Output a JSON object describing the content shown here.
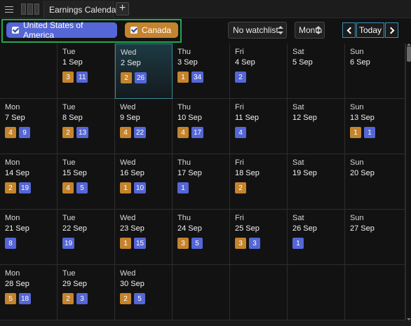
{
  "tab": {
    "title": "Earnings Calendar",
    "add_label": "+"
  },
  "filters": {
    "countries": [
      {
        "key": "usa",
        "label": "United States of America",
        "checked": true,
        "color": "#5566d6"
      },
      {
        "key": "can",
        "label": "Canada",
        "checked": true,
        "color": "#c4842d"
      }
    ],
    "watchlist": "No watchlist",
    "view": "Month",
    "today_label": "Today"
  },
  "calendar": {
    "weeks": [
      [
        null,
        {
          "dow": "Tue",
          "date": "1 Sep",
          "can": "3",
          "usa": "11"
        },
        {
          "dow": "Wed",
          "date": "2 Sep",
          "can": "2",
          "usa": "26",
          "today": true
        },
        {
          "dow": "Thu",
          "date": "3 Sep",
          "can": "1",
          "usa": "34"
        },
        {
          "dow": "Fri",
          "date": "4 Sep",
          "usa": "2"
        },
        {
          "dow": "Sat",
          "date": "5 Sep"
        },
        {
          "dow": "Sun",
          "date": "6 Sep"
        }
      ],
      [
        {
          "dow": "Mon",
          "date": "7 Sep",
          "can": "4",
          "usa": "9"
        },
        {
          "dow": "Tue",
          "date": "8 Sep",
          "can": "2",
          "usa": "13"
        },
        {
          "dow": "Wed",
          "date": "9 Sep",
          "can": "4",
          "usa": "22"
        },
        {
          "dow": "Thu",
          "date": "10 Sep",
          "can": "4",
          "usa": "17"
        },
        {
          "dow": "Fri",
          "date": "11 Sep",
          "usa": "4"
        },
        {
          "dow": "Sat",
          "date": "12 Sep"
        },
        {
          "dow": "Sun",
          "date": "13 Sep",
          "can": "1",
          "usa": "1"
        }
      ],
      [
        {
          "dow": "Mon",
          "date": "14 Sep",
          "can": "2",
          "usa": "19"
        },
        {
          "dow": "Tue",
          "date": "15 Sep",
          "can": "4",
          "usa": "5"
        },
        {
          "dow": "Wed",
          "date": "16 Sep",
          "can": "1",
          "usa": "10"
        },
        {
          "dow": "Thu",
          "date": "17 Sep",
          "usa": "1"
        },
        {
          "dow": "Fri",
          "date": "18 Sep",
          "can": "2"
        },
        {
          "dow": "Sat",
          "date": "19 Sep"
        },
        {
          "dow": "Sun",
          "date": "20 Sep"
        }
      ],
      [
        {
          "dow": "Mon",
          "date": "21 Sep",
          "usa": "8"
        },
        {
          "dow": "Tue",
          "date": "22 Sep",
          "usa": "19"
        },
        {
          "dow": "Wed",
          "date": "23 Sep",
          "can": "1",
          "usa": "15"
        },
        {
          "dow": "Thu",
          "date": "24 Sep",
          "can": "3",
          "usa": "5"
        },
        {
          "dow": "Fri",
          "date": "25 Sep",
          "can": "3",
          "usa": "3"
        },
        {
          "dow": "Sat",
          "date": "26 Sep",
          "usa": "1"
        },
        {
          "dow": "Sun",
          "date": "27 Sep"
        }
      ],
      [
        {
          "dow": "Mon",
          "date": "28 Sep",
          "can": "5",
          "usa": "18"
        },
        {
          "dow": "Tue",
          "date": "29 Sep",
          "can": "2",
          "usa": "3"
        },
        {
          "dow": "Wed",
          "date": "30 Sep",
          "can": "2",
          "usa": "5"
        },
        null,
        null,
        null,
        null
      ]
    ]
  }
}
